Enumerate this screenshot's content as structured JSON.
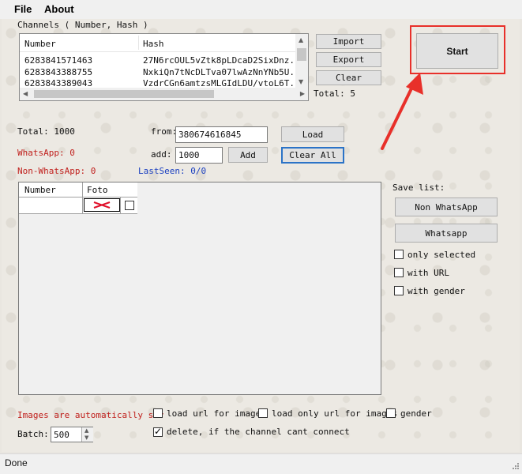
{
  "menu": {
    "file": "File",
    "about": "About"
  },
  "channels": {
    "title": "Channels ( Number, Hash )",
    "columns": [
      "Number",
      "Hash"
    ],
    "rows": [
      {
        "number": "6283841571463",
        "hash": "27N6rcOUL5vZtk8pLDcaD2SixDnz..."
      },
      {
        "number": "6283843388755",
        "hash": "NxkiQn7tNcDLTva07lwAzNnYNb5U..."
      },
      {
        "number": "6283843389043",
        "hash": "VzdrCGn6amtzsMLGIdLDU/vtoL6T..."
      }
    ],
    "import_label": "Import",
    "export_label": "Export",
    "clear_label": "Clear",
    "total_label": "Total: 5"
  },
  "start_label": "Start",
  "stats": {
    "total": "Total: 1000",
    "whatsapp": "WhatsApp: 0",
    "non_whatsapp": "Non-WhatsApp: 0",
    "lastseen": "LastSeen: 0/0"
  },
  "generator": {
    "from_label": "from:",
    "from_value": "380674616845",
    "add_label": "add:",
    "add_value": "1000",
    "add_button": "Add",
    "load_button": "Load",
    "clear_all_button": "Clear All"
  },
  "results": {
    "columns": [
      "Number",
      "Foto"
    ]
  },
  "save_list": {
    "title": "Save list:",
    "non_whatsapp_button": "Non WhatsApp",
    "whatsapp_button": "Whatsapp",
    "only_selected": "only selected",
    "with_url": "with URL",
    "with_gender": "with gender"
  },
  "options": {
    "images_notice": "Images are automatically sav",
    "load_url": "load url for images",
    "load_only_url": "load only url for images",
    "gender": "gender",
    "delete_label": "delete, if the channel cant connect",
    "batch_label": "Batch:",
    "batch_value": "500"
  },
  "status": {
    "text": "Done"
  },
  "colors": {
    "highlight": "#e8302a",
    "accent_red": "#c0201d",
    "accent_blue": "#1a3fc0"
  }
}
